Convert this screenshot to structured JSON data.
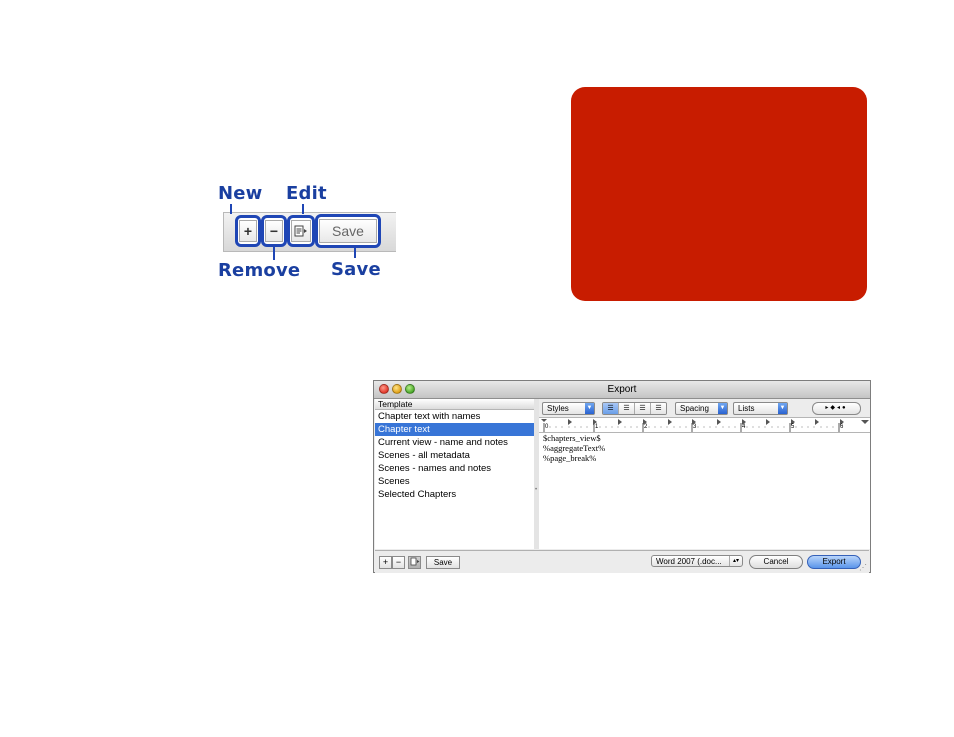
{
  "callout": {
    "new_label": "New",
    "edit_label": "Edit",
    "remove_label": "Remove",
    "save_label": "Save",
    "plus_glyph": "+",
    "minus_glyph": "−",
    "save_button_text": "Save"
  },
  "red_box": {
    "color": "#c81c00"
  },
  "window": {
    "title": "Export",
    "template_header": "Template",
    "templates": [
      "Chapter text with names",
      "Chapter text",
      "Current view - name and notes",
      "Scenes - all metadata",
      "Scenes - names and notes",
      "Scenes",
      "Selected Chapters"
    ],
    "selected_template_index": 1,
    "toolbar": {
      "styles": "Styles",
      "spacing": "Spacing",
      "lists": "Lists"
    },
    "ruler_numbers": [
      "0",
      "1",
      "2",
      "3",
      "4",
      "5",
      "6"
    ],
    "editor_lines": [
      "$chapters_view$",
      "%aggregateText%",
      "%page_break%"
    ],
    "bottom": {
      "plus": "+",
      "minus": "−",
      "save": "Save",
      "format": "Word 2007 (.doc...",
      "cancel": "Cancel",
      "export": "Export"
    }
  },
  "colors": {
    "accent_blue": "#1f46b5",
    "selection": "#3875d7"
  }
}
